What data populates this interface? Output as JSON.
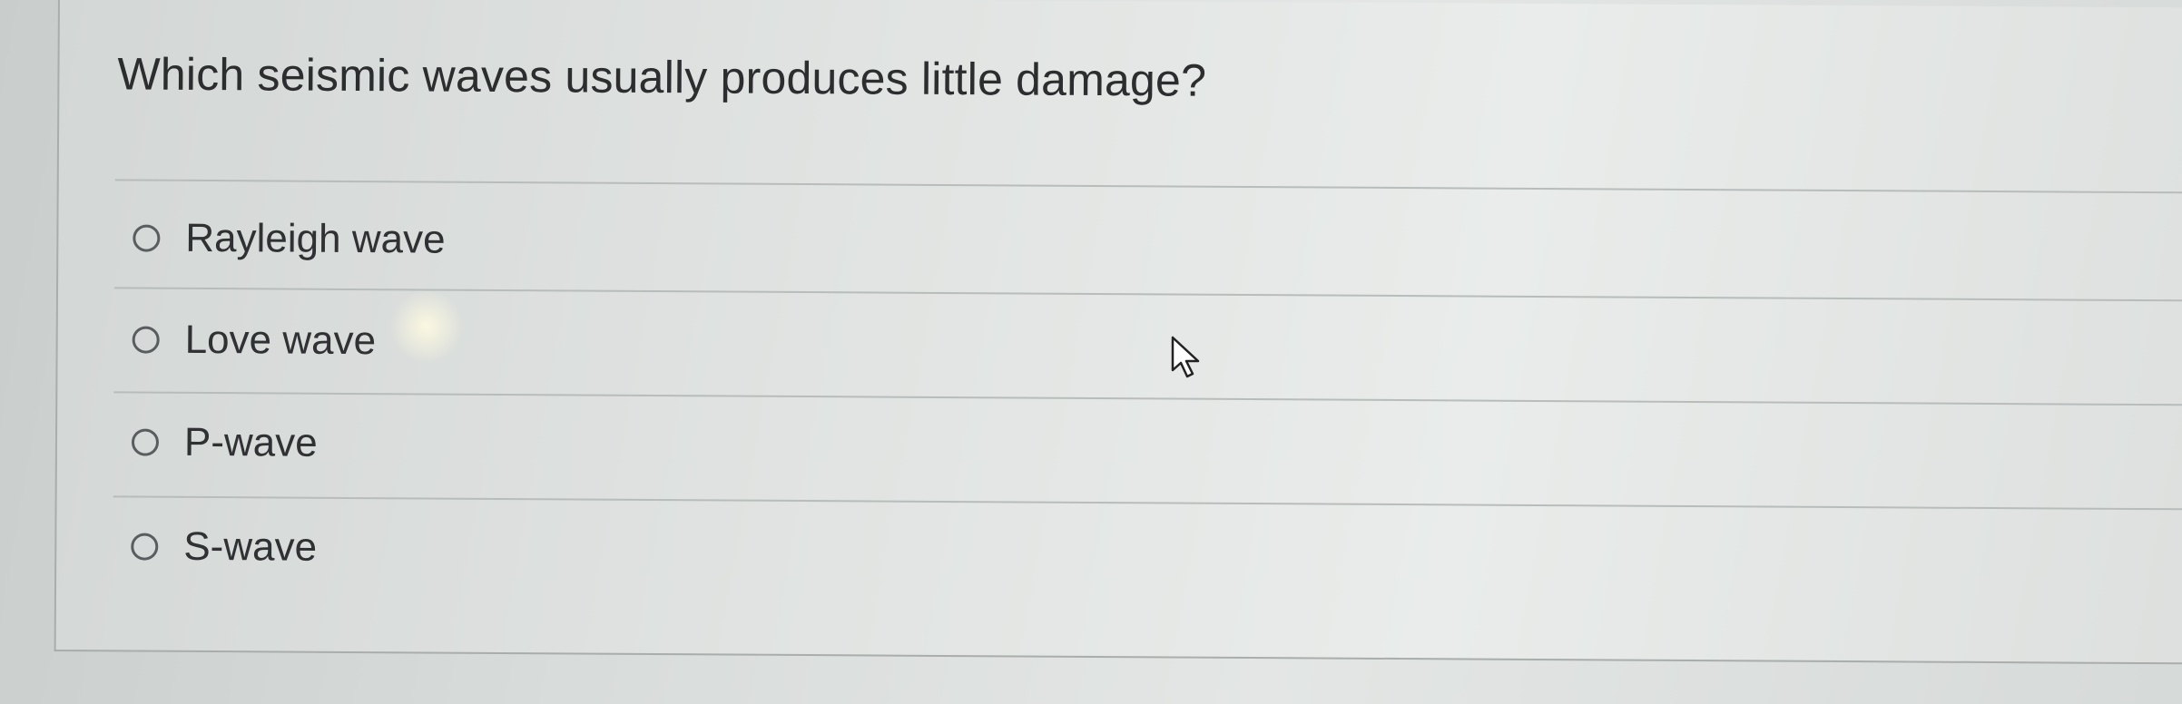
{
  "question": {
    "text": "Which seismic waves usually produces little damage?"
  },
  "options": [
    {
      "label": "Rayleigh wave",
      "selected": false
    },
    {
      "label": "Love wave",
      "selected": false
    },
    {
      "label": "P-wave",
      "selected": false
    },
    {
      "label": "S-wave",
      "selected": false
    }
  ],
  "cursor": {
    "icon": "arrow-pointer-icon"
  }
}
